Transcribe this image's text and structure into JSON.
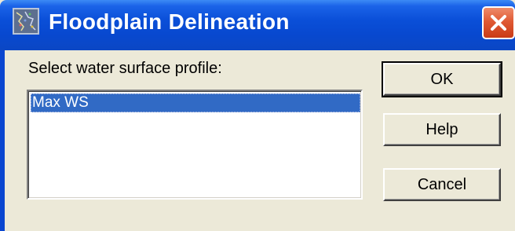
{
  "window": {
    "title": "Floodplain Delineation",
    "icon": "map-grid-icon",
    "close_icon": "close-icon",
    "accent_title_color": "#0a4fd8",
    "close_color": "#e05a34"
  },
  "content": {
    "prompt": "Select water surface profile:",
    "profiles": [
      "Max WS"
    ],
    "selected_profile": "Max WS",
    "selection_color": "#316ac5"
  },
  "buttons": {
    "ok": "OK",
    "help": "Help",
    "cancel": "Cancel"
  }
}
